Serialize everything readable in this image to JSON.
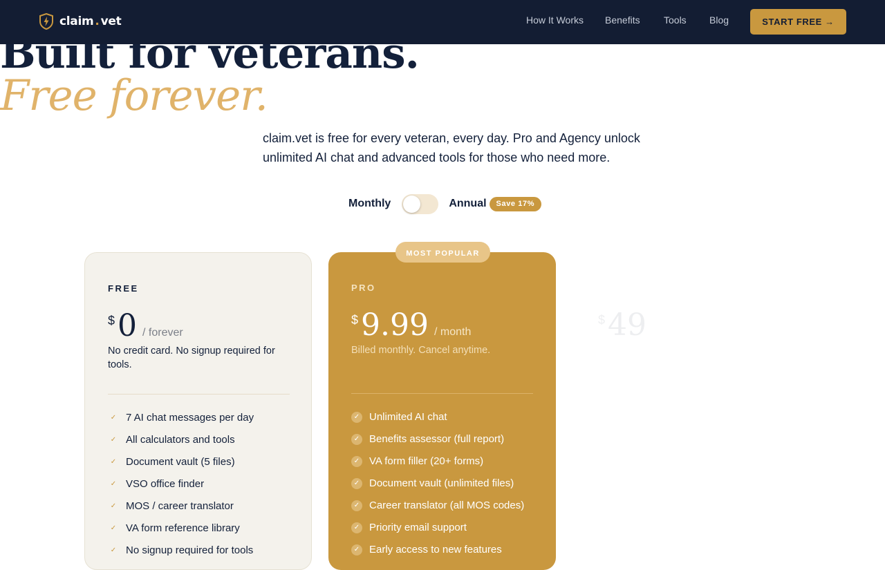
{
  "nav": {
    "brand_left": "claim",
    "brand_dot": ".",
    "brand_right": "vet",
    "links": [
      "How It Works",
      "Benefits",
      "Tools",
      "Blog"
    ],
    "cta": "START FREE →"
  },
  "hero": {
    "title": "Built for veterans.",
    "subtitle": "Free forever.",
    "intro": "claim.vet is free for every veteran, every day. Pro and Agency unlock unlimited AI chat and advanced tools for those who need more."
  },
  "billing": {
    "monthly": "Monthly",
    "annual": "Annual",
    "save": "Save 17%"
  },
  "plans": {
    "popular_badge": "MOST POPULAR",
    "free": {
      "tier": "FREE",
      "currency": "$",
      "amount": "0",
      "period": "/ forever",
      "note": "No credit card. No signup required for tools.",
      "features": [
        "7 AI chat messages per day",
        "All calculators and tools",
        "Document vault (5 files)",
        "VSO office finder",
        "MOS / career translator",
        "VA form reference library",
        "No signup required for tools"
      ]
    },
    "pro": {
      "tier": "PRO",
      "currency": "$",
      "amount": "9.99",
      "period": "/ month",
      "note": "Billed monthly. Cancel anytime.",
      "features": [
        "Unlimited AI chat",
        "Benefits assessor (full report)",
        "VA form filler (20+ forms)",
        "Document vault (unlimited files)",
        "Career translator (all MOS codes)",
        "Priority email support",
        "Early access to new features"
      ]
    },
    "agency": {
      "currency": "$",
      "amount": "49"
    }
  },
  "colors": {
    "navy": "#131d33",
    "gold": "#c9983f",
    "gold_light": "#e0b36a",
    "cream": "#f4f2ec"
  }
}
